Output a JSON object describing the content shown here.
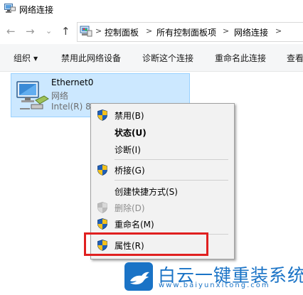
{
  "window": {
    "title": "网络连接"
  },
  "nav": {
    "back": "←",
    "forward": "→",
    "recent": "⌄",
    "up": "↑"
  },
  "breadcrumb": [
    "控制面板",
    "所有控制面板项",
    "网络连接"
  ],
  "toolbar": {
    "organize": "组织",
    "disable": "禁用此网络设备",
    "diagnose": "诊断这个连接",
    "rename": "重命名此连接",
    "view": "查看"
  },
  "connection": {
    "name": "Ethernet0",
    "type": "网络",
    "adapter": "Intel(R) 82"
  },
  "context_menu": {
    "items": [
      {
        "label": "禁用(B)",
        "icon": "uac-shield-icon",
        "bold": false,
        "disabled": false
      },
      {
        "label": "状态(U)",
        "icon": "",
        "bold": true,
        "disabled": false
      },
      {
        "label": "诊断(I)",
        "icon": "",
        "bold": false,
        "disabled": false
      },
      {
        "label": "桥接(G)",
        "icon": "uac-shield-icon",
        "bold": false,
        "disabled": false
      },
      {
        "label": "创建快捷方式(S)",
        "icon": "",
        "bold": false,
        "disabled": false
      },
      {
        "label": "删除(D)",
        "icon": "uac-shield-icon",
        "bold": false,
        "disabled": true
      },
      {
        "label": "重命名(M)",
        "icon": "uac-shield-icon",
        "bold": false,
        "disabled": false
      },
      {
        "label": "属性(R)",
        "icon": "uac-shield-icon",
        "bold": false,
        "disabled": false
      }
    ],
    "highlighted_item": "属性(R)",
    "highlight_color": "#e02020"
  },
  "watermark": {
    "title": "白云一键重装系统",
    "url": "www.baiyunxitong.com",
    "color": "#1a73c6"
  }
}
